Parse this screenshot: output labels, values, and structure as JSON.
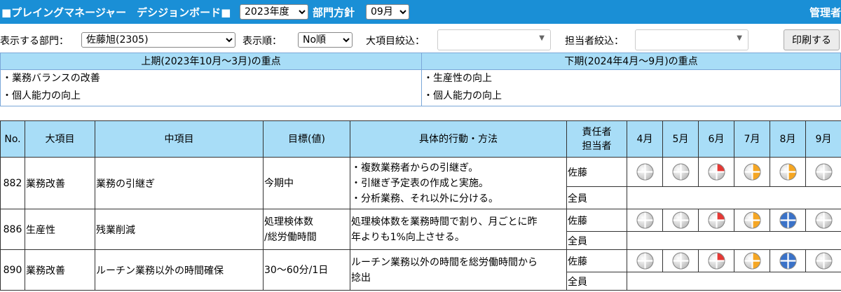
{
  "header": {
    "title": "■プレイングマネージャー　デシジョンボード■",
    "year_selected": "2023年度",
    "policy_label": "部門方針",
    "month_selected": "09月",
    "admin_label": "管理者"
  },
  "filters": {
    "dept_label": "表示する部門：",
    "dept_selected": "佐藤旭(2305)",
    "order_label": "表示順：",
    "order_selected": "No順",
    "major_label": "大項目絞込：",
    "owner_label": "担当者絞込：",
    "print_label": "印刷する"
  },
  "focus": {
    "first_half_title": "上期(2023年10月～3月)の重点",
    "first_half_items": [
      "・業務バランスの改善",
      "・個人能力の向上"
    ],
    "second_half_title": "下期(2024年4月～9月)の重点",
    "second_half_items": [
      "・生産性の向上",
      "・個人能力の向上"
    ]
  },
  "table": {
    "headers": {
      "no": "No.",
      "major": "大項目",
      "middle": "中項目",
      "target": "目標(値)",
      "action": "具体的行動・方法",
      "owner_line1": "責任者",
      "owner_line2": "担当者",
      "months": [
        "4月",
        "5月",
        "6月",
        "7月",
        "8月",
        "9月"
      ]
    },
    "rows": [
      {
        "no": "882",
        "major": "業務改善",
        "middle": "業務の引継ぎ",
        "target_lines": [
          "今期中"
        ],
        "action_lines": [
          "・複数業務者からの引継ぎ。",
          "・引継ぎ予定表の作成と実施。",
          "・分析業務、それ以外に分ける。"
        ],
        "responsible": "佐藤",
        "assignee": "全員",
        "marks": [
          "gray",
          "gray",
          "red",
          "orange",
          "orange",
          "gray"
        ]
      },
      {
        "no": "886",
        "major": "生産性",
        "middle": "残業削減",
        "target_lines": [
          "処理検体数",
          "/総労働時間"
        ],
        "action_lines": [
          "処理検体数を業務時間で割り、月ごとに昨",
          "年よりも1%向上させる。"
        ],
        "responsible": "佐藤",
        "assignee": "全員",
        "marks": [
          "gray",
          "gray",
          "red",
          "orange",
          "blue",
          "gray"
        ]
      },
      {
        "no": "890",
        "major": "業務改善",
        "middle": "ルーチン業務以外の時間確保",
        "target_lines": [
          "30～60分/1日"
        ],
        "action_lines": [
          "ルーチン業務以外の時間を総労働時間から",
          "捻出"
        ],
        "responsible": "佐藤",
        "assignee": "全員",
        "marks": [
          "gray",
          "gray",
          "red",
          "orange",
          "blue",
          "gray"
        ]
      }
    ]
  },
  "colors": {
    "header_bar": "#1a8fd6",
    "table_header": "#a8ddf7",
    "mark_gray": "#bdbdbd",
    "mark_red": "#e53935",
    "mark_orange": "#f5a623",
    "mark_blue": "#3a72c8"
  },
  "icons": {
    "mark": "quarter-circle-progress-icon"
  }
}
